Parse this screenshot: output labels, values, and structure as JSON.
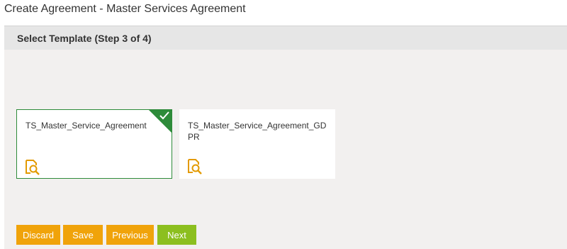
{
  "page": {
    "title": "Create Agreement - Master Services Agreement"
  },
  "step": {
    "title": "Select Template (Step 3 of 4)"
  },
  "templates": [
    {
      "name": "TS_Master_Service_Agreement",
      "selected": true,
      "icon": "preview-icon"
    },
    {
      "name": "TS_Master_Service_Agreement_GDPR",
      "selected": false,
      "icon": "preview-icon"
    }
  ],
  "buttons": {
    "discard": "Discard",
    "save": "Save",
    "previous": "Previous",
    "next": "Next"
  },
  "colors": {
    "accent_orange": "#f0a30a",
    "accent_green": "#8cbf1f",
    "selected_border": "#2e8b3a"
  }
}
